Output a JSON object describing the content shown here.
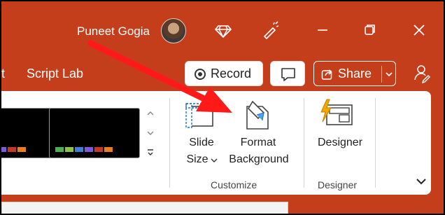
{
  "titlebar": {
    "user_name": "Puneet Gogia",
    "icons": [
      "avatar",
      "diamond-icon",
      "magic-wand-icon",
      "minimize-icon",
      "restore-icon",
      "close-icon"
    ]
  },
  "command_row": {
    "partial_tab": "t",
    "tab_script_lab": "Script Lab",
    "record_label": "Record",
    "share_label": "Share"
  },
  "ribbon": {
    "slide_size_line1": "Slide",
    "slide_size_line2": "Size",
    "format_bg_line1": "Format",
    "format_bg_line2": "Background",
    "designer_label": "Designer",
    "group_customize": "Customize",
    "group_designer": "Designer",
    "thumb_colors": [
      "#4caf50",
      "#8bc34a",
      "#3f7fd6",
      "#7b5cd6",
      "#c0392b",
      "#e67e22"
    ]
  },
  "colors": {
    "accent": "#c43e1c",
    "annotation_arrow": "#ff1a1a"
  }
}
